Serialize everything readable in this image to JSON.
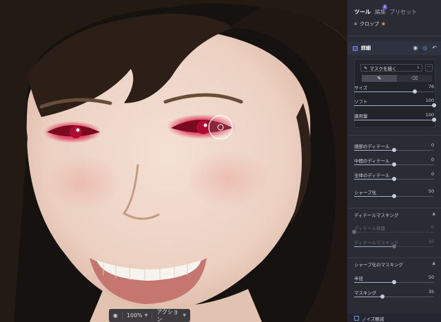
{
  "tabs": {
    "tools": "ツール",
    "edit": "編集",
    "edit_badge": "2",
    "presets": "プリセット"
  },
  "crop": {
    "label": "クロップ",
    "pro_mark": "■"
  },
  "detail": {
    "title": "詳細",
    "icons": [
      "eye-icon",
      "mask-icon",
      "undo-icon"
    ]
  },
  "mask": {
    "select_value": "マスクを描く",
    "more": "···",
    "brush_icon": "brush-icon",
    "eraser_icon": "eraser-icon",
    "sliders": [
      {
        "label": "サイズ",
        "value": "76",
        "level": 0.76
      },
      {
        "label": "ソフト",
        "value": "100",
        "level": 1.0
      },
      {
        "label": "適用量",
        "value": "100",
        "level": 1.0
      }
    ]
  },
  "detail_sliders": [
    {
      "label": "細部のディテール",
      "value": "0",
      "level": 0.5
    },
    {
      "label": "中間のディテール",
      "value": "0",
      "level": 0.5
    },
    {
      "label": "全体のディテール",
      "value": "0",
      "level": 0.5
    },
    {
      "label": "シャープ化",
      "value": "50",
      "level": 0.5
    }
  ],
  "detail_masking": {
    "title": "ディテールマスキング",
    "sliders": [
      {
        "label": "ディテール保護",
        "value": "0",
        "level": 0.0
      },
      {
        "label": "ディテールマスキング",
        "value": "50",
        "level": 0.5
      }
    ]
  },
  "sharpen_masking": {
    "title": "シャープ化のマスキング",
    "sliders": [
      {
        "label": "半径",
        "value": "50",
        "level": 0.5
      },
      {
        "label": "マスキング",
        "value": "35",
        "level": 0.35
      }
    ]
  },
  "noise": {
    "title": "ノイズ軽減"
  },
  "canvas_bar": {
    "zoom": "100%",
    "actions": "アクション"
  },
  "colors": {
    "panel_bg": "#292c35",
    "accent": "#6f8fe0",
    "pro_orange": "#e0884a",
    "red_eye": "#c01030"
  }
}
